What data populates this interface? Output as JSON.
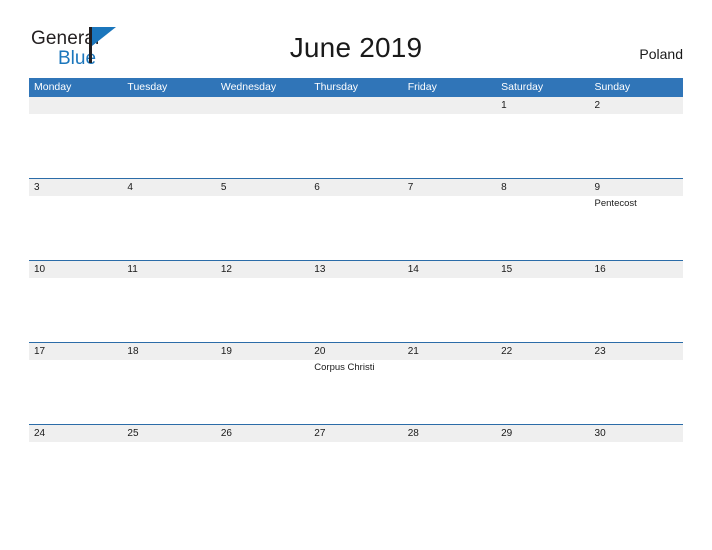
{
  "brand": {
    "name_part1": "General",
    "name_part2": "Blue",
    "flag_color": "#1b76bc"
  },
  "header": {
    "title": "June 2019",
    "region": "Poland"
  },
  "calendar": {
    "accent_color": "#3075b8",
    "band_color": "#efefef",
    "weekday_headers": [
      "Monday",
      "Tuesday",
      "Wednesday",
      "Thursday",
      "Friday",
      "Saturday",
      "Sunday"
    ],
    "weeks": [
      [
        {
          "day": "",
          "events": []
        },
        {
          "day": "",
          "events": []
        },
        {
          "day": "",
          "events": []
        },
        {
          "day": "",
          "events": []
        },
        {
          "day": "",
          "events": []
        },
        {
          "day": "1",
          "events": []
        },
        {
          "day": "2",
          "events": []
        }
      ],
      [
        {
          "day": "3",
          "events": []
        },
        {
          "day": "4",
          "events": []
        },
        {
          "day": "5",
          "events": []
        },
        {
          "day": "6",
          "events": []
        },
        {
          "day": "7",
          "events": []
        },
        {
          "day": "8",
          "events": []
        },
        {
          "day": "9",
          "events": [
            "Pentecost"
          ]
        }
      ],
      [
        {
          "day": "10",
          "events": []
        },
        {
          "day": "11",
          "events": []
        },
        {
          "day": "12",
          "events": []
        },
        {
          "day": "13",
          "events": []
        },
        {
          "day": "14",
          "events": []
        },
        {
          "day": "15",
          "events": []
        },
        {
          "day": "16",
          "events": []
        }
      ],
      [
        {
          "day": "17",
          "events": []
        },
        {
          "day": "18",
          "events": []
        },
        {
          "day": "19",
          "events": []
        },
        {
          "day": "20",
          "events": [
            "Corpus Christi"
          ]
        },
        {
          "day": "21",
          "events": []
        },
        {
          "day": "22",
          "events": []
        },
        {
          "day": "23",
          "events": []
        }
      ],
      [
        {
          "day": "24",
          "events": []
        },
        {
          "day": "25",
          "events": []
        },
        {
          "day": "26",
          "events": []
        },
        {
          "day": "27",
          "events": []
        },
        {
          "day": "28",
          "events": []
        },
        {
          "day": "29",
          "events": []
        },
        {
          "day": "30",
          "events": []
        }
      ]
    ]
  }
}
